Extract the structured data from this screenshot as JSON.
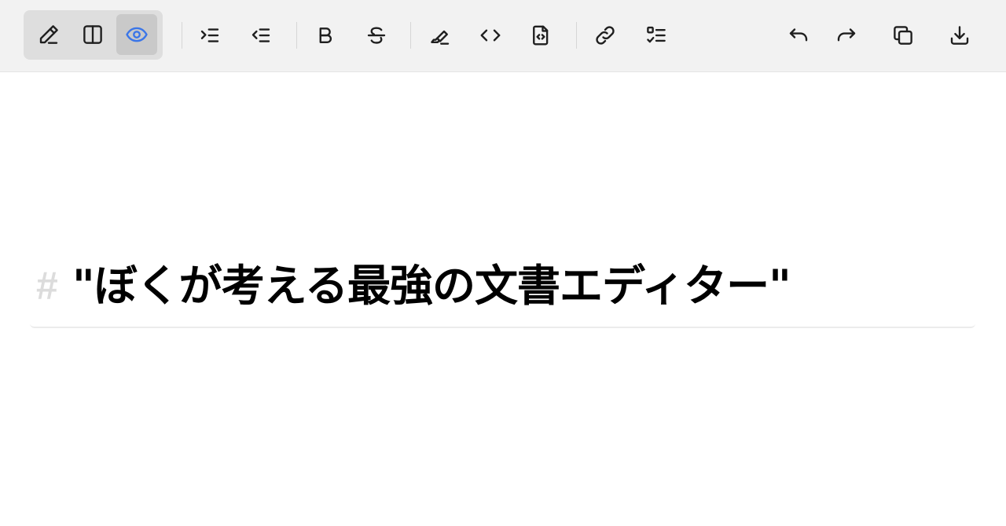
{
  "toolbar": {
    "colors": {
      "background": "#f2f2f2",
      "active_icon": "#3b76e8",
      "icon": "#1f1f1f"
    },
    "view_modes": [
      {
        "icon": "pencil-icon",
        "label": "Edit",
        "active": false
      },
      {
        "icon": "split-view-icon",
        "label": "Split view",
        "active": false
      },
      {
        "icon": "eye-icon",
        "label": "Preview",
        "active": true
      }
    ],
    "buttons": [
      {
        "icon": "indent-icon",
        "label": "Indent"
      },
      {
        "icon": "outdent-icon",
        "label": "Outdent"
      },
      {
        "icon": "bold-icon",
        "label": "Bold"
      },
      {
        "icon": "strikethrough-icon",
        "label": "Strikethrough"
      },
      {
        "icon": "highlight-icon",
        "label": "Highlight"
      },
      {
        "icon": "code-icon",
        "label": "Inline code"
      },
      {
        "icon": "code-file-icon",
        "label": "Code block"
      },
      {
        "icon": "link-icon",
        "label": "Link"
      },
      {
        "icon": "task-list-icon",
        "label": "Task list"
      },
      {
        "icon": "undo-icon",
        "label": "Undo"
      },
      {
        "icon": "redo-icon",
        "label": "Redo"
      },
      {
        "icon": "copy-icon",
        "label": "Copy"
      },
      {
        "icon": "download-icon",
        "label": "Download"
      }
    ]
  },
  "editor": {
    "heading_marker": "#",
    "heading_text": "\"ぼくが考える最強の文書エディター\""
  }
}
